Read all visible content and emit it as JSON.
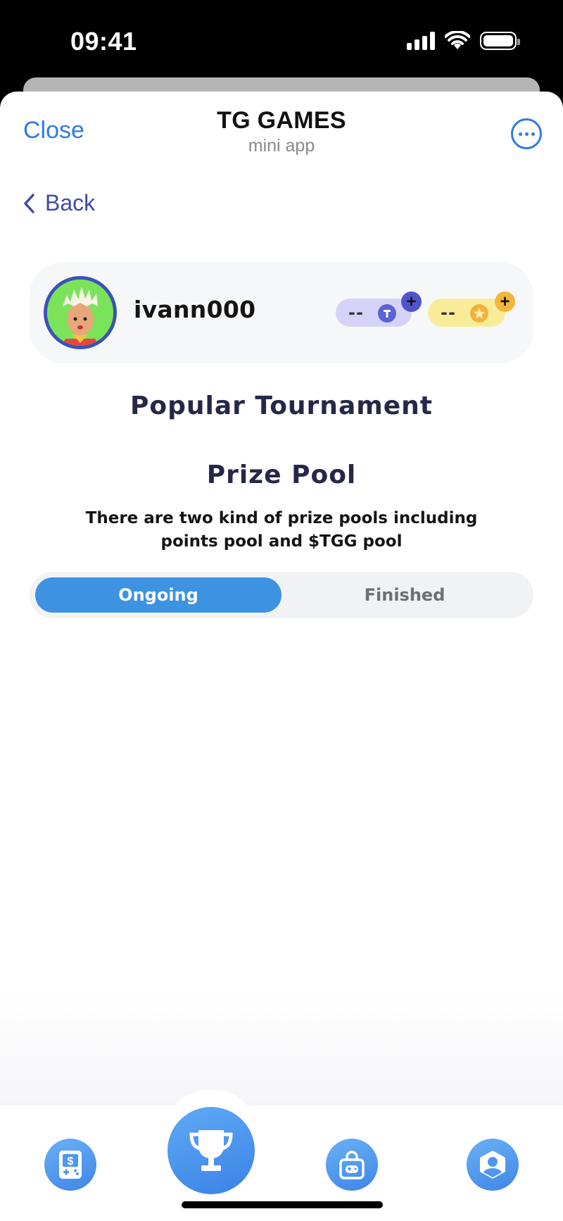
{
  "status_bar": {
    "time": "09:41"
  },
  "header": {
    "close_label": "Close",
    "title": "TG GAMES",
    "subtitle": "mini app"
  },
  "nav": {
    "back_label": "Back"
  },
  "profile": {
    "username": "ivann000",
    "tgg_balance": "--",
    "points_balance": "--"
  },
  "main": {
    "heading": "Popular Tournament",
    "prize_pool_title": "Prize Pool",
    "prize_pool_description": "There are two kind of prize pools including points pool and $TGG pool",
    "tabs": [
      {
        "label": "Ongoing",
        "active": true
      },
      {
        "label": "Finished",
        "active": false
      }
    ]
  },
  "bottom_nav": {
    "items": [
      {
        "icon": "game-console-icon"
      },
      {
        "icon": "trophy-icon",
        "active": true
      },
      {
        "icon": "shop-bag-icon"
      },
      {
        "icon": "profile-icon"
      }
    ]
  },
  "colors": {
    "accent": "#2f7ae5",
    "tab_active": "#3d93e2",
    "heading": "#262848",
    "tgg_pill": "#d4d3f7",
    "points_pill": "#f9ec99"
  }
}
